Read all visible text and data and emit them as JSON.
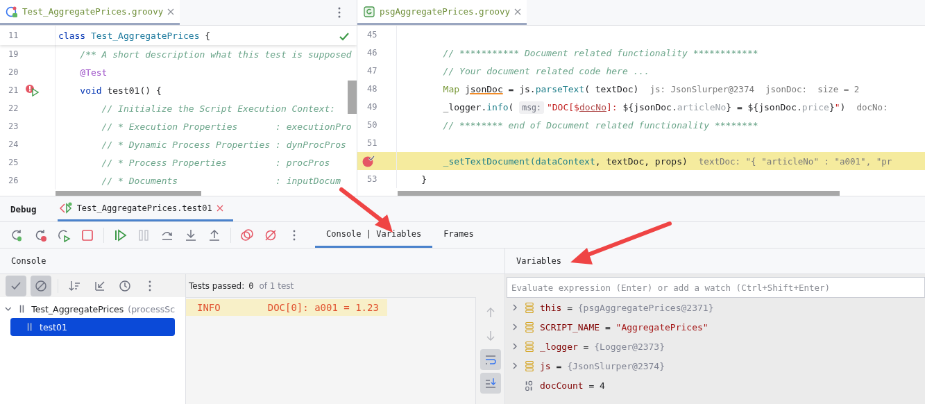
{
  "left_editor": {
    "tab": {
      "label": "Test_AggregatePrices.groovy",
      "selected": true
    },
    "sticky_line": {
      "number": "11",
      "tokens": [
        {
          "text": "class ",
          "kind": "kw"
        },
        {
          "text": "Test_AggregatePrices",
          "kind": "cls"
        },
        {
          "text": " {",
          "kind": "plain"
        }
      ]
    },
    "lines": [
      {
        "kind": "code",
        "number": "19",
        "tokens": [
          {
            "text": "    /** A short description what this test is supposed",
            "kind": "comment"
          }
        ]
      },
      {
        "kind": "code",
        "number": "20",
        "tokens": [
          {
            "text": "    @Test",
            "kind": "annot"
          }
        ]
      },
      {
        "kind": "breakpoint_run",
        "number": "21",
        "tokens": [
          {
            "text": "    void",
            "kind": "kw"
          },
          {
            "text": " test01() {",
            "kind": "plain"
          }
        ]
      },
      {
        "kind": "code",
        "number": "22",
        "tokens": [
          {
            "text": "        // Initialize the Script Execution Context:",
            "kind": "comment"
          }
        ]
      },
      {
        "kind": "code",
        "number": "23",
        "tokens": [
          {
            "text": "        // * Execution Properties       : executionPro",
            "kind": "comment"
          }
        ]
      },
      {
        "kind": "code",
        "number": "24",
        "tokens": [
          {
            "text": "        // * Dynamic Process Properties : dynProcPros",
            "kind": "comment"
          }
        ]
      },
      {
        "kind": "code",
        "number": "25",
        "tokens": [
          {
            "text": "        // * Process Properties         : procPros",
            "kind": "comment"
          }
        ]
      },
      {
        "kind": "code",
        "number": "26",
        "tokens": [
          {
            "text": "        // * Documents                  : inputDocum",
            "kind": "comment"
          }
        ]
      }
    ]
  },
  "right_editor": {
    "tab": {
      "label": "psgAggregatePrices.groovy",
      "selected": true
    },
    "lines": [
      {
        "kind": "code",
        "number": "45",
        "current": false
      },
      {
        "kind": "code",
        "number": "46",
        "current": false,
        "tokens": [
          {
            "text": "        // *********** Document related functionality ************",
            "kind": "comment"
          }
        ]
      },
      {
        "kind": "code",
        "number": "47",
        "current": false,
        "tokens": [
          {
            "text": "        // Your document related code here ...",
            "kind": "comment"
          }
        ]
      },
      {
        "kind": "code",
        "number": "48",
        "current": false,
        "tokens": [
          {
            "text": "        Map ",
            "kind": "type"
          },
          {
            "text": "jsonDoc",
            "kind": "warn"
          },
          {
            "text": " = js.",
            "kind": "plain"
          },
          {
            "text": "parseText",
            "kind": "method"
          },
          {
            "text": "( textDoc)",
            "kind": "plain"
          },
          {
            "text": "js: JsonSlurper@2374",
            "kind": "hint"
          },
          {
            "text": "jsonDoc:  size = 2",
            "kind": "hint"
          }
        ]
      },
      {
        "kind": "code",
        "number": "49",
        "current": false,
        "tokens": [
          {
            "text": "        _logger.",
            "kind": "plain"
          },
          {
            "text": "info",
            "kind": "method"
          },
          {
            "text": "( ",
            "kind": "plain"
          },
          {
            "text": "msg:",
            "kind": "chip"
          },
          {
            "text": "\"DOC[$",
            "kind": "str"
          },
          {
            "text": "docNo",
            "kind": "interp"
          },
          {
            "text": "]: ",
            "kind": "str"
          },
          {
            "text": "${jsonDoc.",
            "kind": "plain"
          },
          {
            "text": "articleNo",
            "kind": "prop"
          },
          {
            "text": "} = ${jsonDoc.",
            "kind": "plain"
          },
          {
            "text": "price",
            "kind": "prop"
          },
          {
            "text": "}",
            "kind": "plain"
          },
          {
            "text": "\"",
            "kind": "str"
          },
          {
            "text": ")",
            "kind": "plain"
          },
          {
            "text": "docNo:",
            "kind": "hint"
          }
        ]
      },
      {
        "kind": "code",
        "number": "50",
        "current": false,
        "tokens": [
          {
            "text": "        // ******** end of Document related functionality ********",
            "kind": "comment"
          }
        ]
      },
      {
        "kind": "code",
        "number": "51",
        "current": false
      },
      {
        "kind": "breakpoint_hit",
        "current": true,
        "tokens": [
          {
            "text": "        _setTextDocument(dataContext",
            "kind": "method"
          },
          {
            "text": ", textDoc, props)",
            "kind": "plain"
          },
          {
            "text": "textDoc: \"{ \"articleNo\" : \"a001\", \"pr",
            "kind": "hint"
          }
        ]
      },
      {
        "kind": "code",
        "number": "53",
        "current": false,
        "tokens": [
          {
            "text": "    }",
            "kind": "plain"
          }
        ]
      }
    ]
  },
  "debug": {
    "title": "Debug",
    "session_tab": {
      "label": "Test_AggregatePrices.test01",
      "selected": true
    },
    "toolbar": [
      {
        "kind": "rerun_debug",
        "disabled": false
      },
      {
        "kind": "rerun_failed",
        "disabled": false
      },
      {
        "kind": "rerun_changed",
        "disabled": false
      },
      {
        "kind": "stop",
        "disabled": false
      },
      {
        "kind": "separator"
      },
      {
        "kind": "resume",
        "disabled": false
      },
      {
        "kind": "pause",
        "disabled": true
      },
      {
        "kind": "step_over",
        "disabled": false
      },
      {
        "kind": "step_into",
        "disabled": false
      },
      {
        "kind": "step_out",
        "disabled": false
      },
      {
        "kind": "separator"
      },
      {
        "kind": "breakpoints",
        "disabled": false
      },
      {
        "kind": "mute_breakpoints",
        "disabled": false
      },
      {
        "kind": "more",
        "disabled": false
      }
    ],
    "tabs": [
      {
        "label": "Console | Variables",
        "selected": true
      },
      {
        "label": "Frames",
        "selected": false
      }
    ]
  },
  "console": {
    "header": "Console",
    "filters": [
      {
        "kind": "show_passed",
        "selected": true
      },
      {
        "kind": "show_ignored",
        "selected": true
      },
      {
        "kind": "separator"
      },
      {
        "kind": "sort",
        "selected": false
      },
      {
        "kind": "collapse",
        "selected": false
      },
      {
        "kind": "history",
        "selected": false
      },
      {
        "kind": "more",
        "selected": false
      }
    ],
    "tests_passed": {
      "label": "Tests passed:",
      "count": "0",
      "total": "of 1 test"
    },
    "tree": [
      {
        "label": "Test_AggregatePrices",
        "detail": "(processSc",
        "expanded": true,
        "selected": false,
        "children": [
          {
            "label": "test01",
            "selected": true
          }
        ]
      }
    ],
    "output": [
      {
        "level": "INFO",
        "message": "DOC[0]: a001 = 1.23",
        "highlighted": true
      }
    ],
    "side_buttons": [
      {
        "kind": "up",
        "disabled": true,
        "selected": false
      },
      {
        "kind": "down",
        "disabled": true,
        "selected": false
      },
      {
        "kind": "soft_wrap",
        "disabled": false,
        "selected": true
      },
      {
        "kind": "scroll_end",
        "disabled": false,
        "selected": true
      }
    ]
  },
  "variables": {
    "header": "Variables",
    "watch": {
      "placeholder": "Evaluate expression (Enter) or add a watch (Ctrl+Shift+Enter)"
    },
    "items": [
      {
        "kind": "object",
        "expandable": true,
        "name": "this",
        "operator": "=",
        "value": "{psgAggregatePrices@2371}"
      },
      {
        "kind": "string",
        "expandable": true,
        "name": "SCRIPT_NAME",
        "operator": "=",
        "value": "\"AggregatePrices\""
      },
      {
        "kind": "object",
        "expandable": true,
        "name": "_logger",
        "operator": "=",
        "value": "{Logger@2373}"
      },
      {
        "kind": "object",
        "expandable": true,
        "name": "js",
        "operator": "=",
        "value": "{JsonSlurper@2374}"
      },
      {
        "kind": "number",
        "expandable": false,
        "name": "docCount",
        "operator": "=",
        "value": "4"
      }
    ]
  }
}
